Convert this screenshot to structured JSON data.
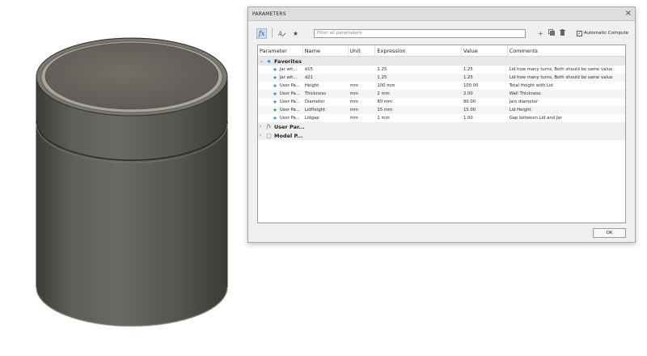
{
  "dialog": {
    "title": "PARAMETERS",
    "close": "×"
  },
  "toolbar": {
    "filter_placeholder": "Filter all parameters",
    "auto_compute_label": "Automatic Compute",
    "auto_compute_checked": true
  },
  "table": {
    "headers": [
      "Parameter",
      "Name",
      "Unit",
      "Expression",
      "Value",
      "Comments"
    ],
    "favorites_label": "Favorites",
    "rows": [
      {
        "parameter": "Jar wit...",
        "name": "d15",
        "unit": "",
        "expression": "1.25",
        "value": "1.25",
        "comment": "Lid how many turns, Both should be same value"
      },
      {
        "parameter": "Jar wit...",
        "name": "d21",
        "unit": "",
        "expression": "1.25",
        "value": "1.25",
        "comment": "Lid how many turns, Both should be same value"
      },
      {
        "parameter": "User Pa...",
        "name": "Height",
        "unit": "mm",
        "expression": "100 mm",
        "value": "100.00",
        "comment": "Total Height with Lid"
      },
      {
        "parameter": "User Pa...",
        "name": "Thickness",
        "unit": "mm",
        "expression": "2 mm",
        "value": "2.00",
        "comment": "Wall Thickness"
      },
      {
        "parameter": "User Pa...",
        "name": "Diameter",
        "unit": "mm",
        "expression": "80 mm",
        "value": "80.00",
        "comment": "Jars diameter"
      },
      {
        "parameter": "User Pa...",
        "name": "LidHeight",
        "unit": "mm",
        "expression": "15 mm",
        "value": "15.00",
        "comment": "Lid Height"
      },
      {
        "parameter": "User Pa...",
        "name": "Lidgap",
        "unit": "mm",
        "expression": "1 mm",
        "value": "1.00",
        "comment": "Gap between Lid and Jar"
      }
    ],
    "user_params_label": "User Par...",
    "model_params_label": "Model P..."
  },
  "buttons": {
    "ok": "OK"
  },
  "icons": {
    "fx": "fx-icon",
    "text_param": "text-parameter-icon",
    "favorite": "star-icon",
    "add": "plus-icon",
    "copy": "copy-icon",
    "delete": "trash-icon"
  },
  "colors": {
    "accent": "#2a8bd3",
    "jar_body": "#55554f"
  }
}
